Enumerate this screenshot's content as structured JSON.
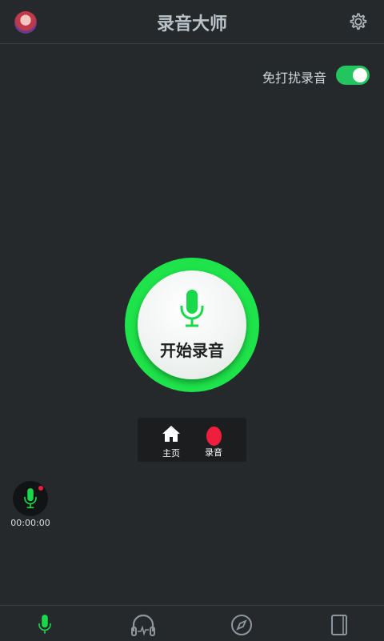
{
  "header": {
    "title": "录音大师"
  },
  "dnd": {
    "label": "免打扰录音",
    "enabled": true
  },
  "record_button": {
    "label": "开始录音"
  },
  "floating_menu": {
    "items": [
      {
        "label": "主页",
        "icon": "home-icon"
      },
      {
        "label": "录音",
        "icon": "record-dot-icon"
      }
    ]
  },
  "mini_recorder": {
    "time": "00:00:00"
  },
  "tabbar": {
    "tabs": [
      {
        "icon": "microphone-icon",
        "active": true
      },
      {
        "icon": "headphones-icon",
        "active": false
      },
      {
        "icon": "compass-icon",
        "active": false
      },
      {
        "icon": "notebook-icon",
        "active": false
      }
    ]
  },
  "colors": {
    "accent": "#1ee34a",
    "background": "#25292c",
    "record_red": "#ef1e3c"
  }
}
